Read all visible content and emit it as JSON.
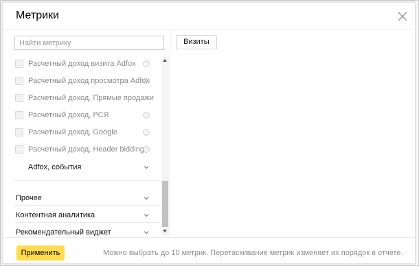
{
  "dialog": {
    "title": "Метрики"
  },
  "search": {
    "placeholder": "Найти метрику",
    "value": ""
  },
  "metric_items": [
    {
      "label": "Расчетный доход визита Adfox",
      "checked": false
    },
    {
      "label": "Расчетный доход просмотра Adfox",
      "checked": false
    },
    {
      "label": "Расчетный доход, Прямые продажи",
      "checked": false
    },
    {
      "label": "Расчетный доход, РСЯ",
      "checked": false
    },
    {
      "label": "Расчетный доход, Google",
      "checked": false
    },
    {
      "label": "Расчетный доход, Header bidding",
      "checked": false
    }
  ],
  "subgroup": {
    "label": "Adfox, события"
  },
  "groups": [
    {
      "label": "Прочее"
    },
    {
      "label": "Контентная аналитика"
    },
    {
      "label": "Рекомендательный виджет"
    }
  ],
  "selected_metrics": [
    {
      "label": "Визиты"
    }
  ],
  "footer": {
    "apply_label": "Применить",
    "note": "Можно выбрать до 10 метрик. Перетаскивание метрик изменяет их порядок в отчете."
  },
  "colors": {
    "apply_button": "#ffdb4d",
    "muted_text": "#8a8a8a"
  },
  "icons": {
    "close": "close-icon",
    "help": "question-circle-icon",
    "chevron": "chevron-down-icon"
  }
}
